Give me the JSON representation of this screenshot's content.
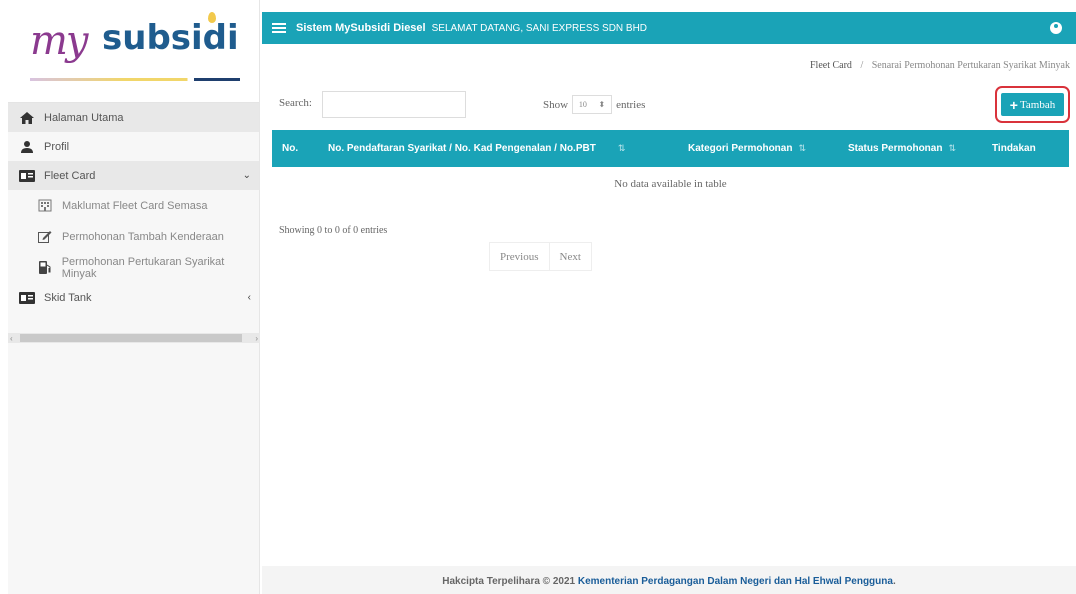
{
  "logo": {
    "prefix": "my",
    "word": "subsidi"
  },
  "header": {
    "system_title": "Sistem MySubsidi Diesel",
    "welcome": "SELAMAT DATANG, SANI EXPRESS SDN BHD"
  },
  "sidebar": {
    "items": [
      {
        "label": "Halaman Utama",
        "icon": "home-icon"
      },
      {
        "label": "Profil",
        "icon": "user-icon"
      },
      {
        "label": "Fleet Card",
        "icon": "id-card-icon",
        "caret": "⌄"
      },
      {
        "label": "Maklumat Fleet Card Semasa",
        "icon": "building-icon"
      },
      {
        "label": "Permohonan Tambah Kenderaan",
        "icon": "edit-icon"
      },
      {
        "label": "Permohonan Pertukaran Syarikat Minyak",
        "icon": "fuel-pump-icon"
      },
      {
        "label": "Skid Tank",
        "icon": "id-card-icon",
        "caret": "‹"
      }
    ]
  },
  "breadcrumb": {
    "parent": "Fleet Card",
    "separator": "/",
    "current": "Senarai Permohonan Pertukaran Syarikat Minyak"
  },
  "controls": {
    "search_label": "Search:",
    "search_value": "",
    "show_label": "Show",
    "entries_value": "10",
    "entries_label": "entries",
    "add_button": "Tambah"
  },
  "table": {
    "columns": [
      "No.",
      "No. Pendaftaran Syarikat / No. Kad Pengenalan / No.PBT",
      "Kategori Permohonan",
      "Status Permohonan",
      "Tindakan"
    ],
    "empty_message": "No data available in table",
    "info": "Showing 0 to 0 of 0 entries",
    "prev": "Previous",
    "next": "Next"
  },
  "footer": {
    "prefix": "Hakcipta Terpelihara © 2021",
    "org": "Kementerian Perdagangan Dalam Negeri dan Hal Ehwal Pengguna",
    "suffix": "."
  },
  "colors": {
    "accent": "#1aa3b7",
    "highlight": "#d9323b"
  }
}
